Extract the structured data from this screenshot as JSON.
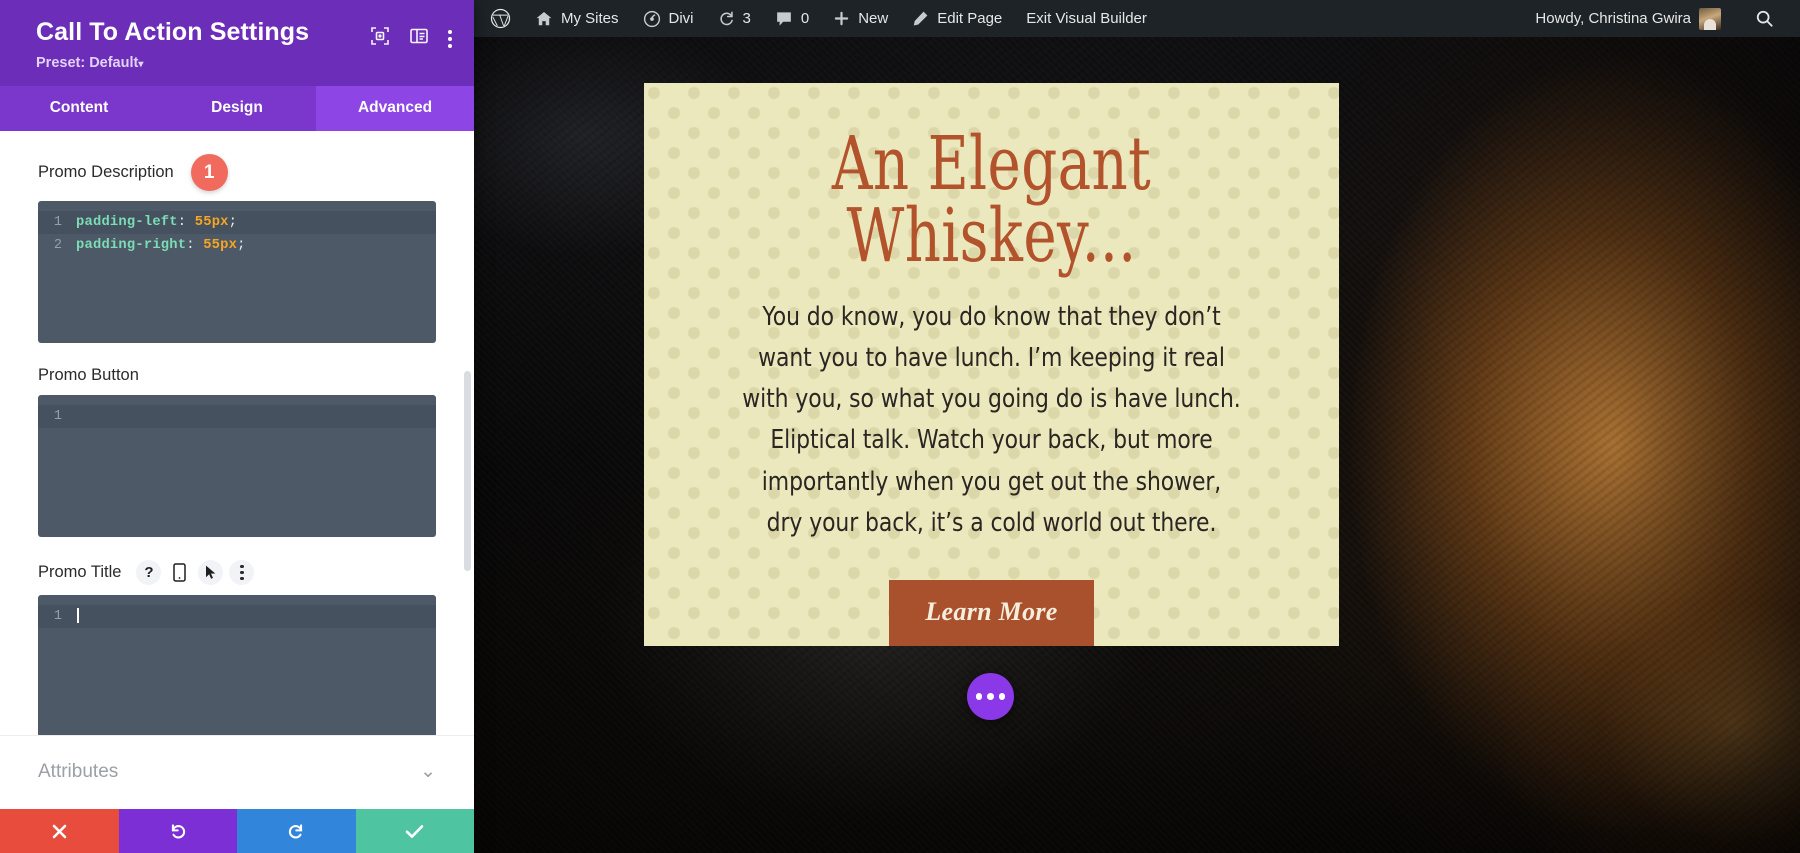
{
  "settings_panel": {
    "title": "Call To Action Settings",
    "preset_label": "Preset: Default",
    "preset_caret": "▾",
    "header_icons": [
      {
        "name": "focus-target-icon"
      },
      {
        "name": "layout-panel-icon"
      },
      {
        "name": "more-options-icon"
      }
    ],
    "tabs": [
      {
        "label": "Content",
        "active": false
      },
      {
        "label": "Design",
        "active": false
      },
      {
        "label": "Advanced",
        "active": true
      }
    ],
    "fields": [
      {
        "label": "Promo Description",
        "badge": "1",
        "lines": [
          {
            "num": "1",
            "property": "padding-left",
            "colon": ": ",
            "value": "55px",
            "semi": ";",
            "highlighted": true
          },
          {
            "num": "2",
            "property": "padding-right",
            "colon": ": ",
            "value": "55px",
            "semi": ";",
            "highlighted": false
          }
        ]
      },
      {
        "label": "Promo Button",
        "lines": [
          {
            "num": "1",
            "property": "",
            "colon": "",
            "value": "",
            "semi": "",
            "highlighted": true
          }
        ]
      },
      {
        "label": "Promo Title",
        "icons": [
          {
            "name": "help-icon",
            "glyph": "?"
          },
          {
            "name": "responsive-mobile-icon"
          },
          {
            "name": "hover-cursor-icon"
          },
          {
            "name": "field-options-icon"
          }
        ],
        "lines": [
          {
            "num": "1",
            "property": "",
            "colon": "",
            "value": "",
            "semi": "",
            "highlighted": true,
            "caret": true
          }
        ]
      }
    ],
    "accordion": {
      "label": "Attributes",
      "chevron": "⌄"
    },
    "footer_buttons": [
      {
        "name": "cancel-button",
        "color": "#E74C3C"
      },
      {
        "name": "undo-button",
        "color": "#7B2FD4"
      },
      {
        "name": "redo-button",
        "color": "#3186DC"
      },
      {
        "name": "save-button",
        "color": "#4FC4A0"
      }
    ]
  },
  "admin_bar": {
    "items": [
      {
        "name": "wordpress-logo-icon",
        "label": ""
      },
      {
        "name": "my-sites-menu",
        "label": "My Sites"
      },
      {
        "name": "divi-menu",
        "label": "Divi"
      },
      {
        "name": "updates-menu",
        "label": "3"
      },
      {
        "name": "comments-menu",
        "label": "0"
      },
      {
        "name": "new-content-menu",
        "label": "New"
      },
      {
        "name": "edit-page-menu",
        "label": "Edit Page"
      },
      {
        "name": "exit-visual-builder",
        "label": "Exit Visual Builder"
      }
    ],
    "user_greeting": "Howdy, Christina Gwira",
    "search_label": ""
  },
  "preview": {
    "cta": {
      "title_line1": "An Elegant",
      "title_line2": "Whiskey...",
      "description": "You do know, you do know that they don’t want you to have lunch. I’m keeping it real with you, so what you going do is have lunch. Eliptical talk. Watch your back, but more importantly when you get out the shower, dry your back, it’s a cold world out there.",
      "button_label": "Learn More"
    },
    "fab": {
      "name": "divi-menu-fab"
    }
  },
  "colors": {
    "panel_header_purple": "#6C2EB9",
    "tab_active_purple": "#8E45E6",
    "code_bg": "#4E5967",
    "badge_red": "#F06A5D",
    "cta_cream": "#ECE8BE",
    "cta_rust": "#B2532C",
    "cta_button": "#A9502C",
    "fab_purple": "#8B39E8",
    "admin_bar": "#1D2327"
  }
}
